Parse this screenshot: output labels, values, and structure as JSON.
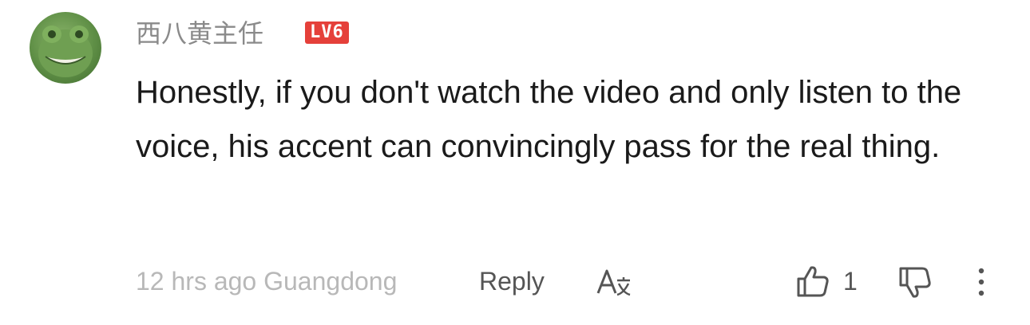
{
  "comment": {
    "username": "西八黄主任",
    "level_badge": "LV6",
    "text": "Honestly, if you don't watch the video and only listen to the voice, his accent can convincingly pass for the real thing.",
    "meta": "12 hrs ago Guangdong",
    "reply_label": "Reply",
    "like_count": "1",
    "icons": {
      "translate": "translate-icon",
      "like": "thumbs-up-icon",
      "dislike": "thumbs-down-icon",
      "more": "more-vertical-icon",
      "avatar": "avatar"
    },
    "colors": {
      "badge": "#e5403a",
      "text": "#1a1a1a",
      "muted": "#b8b8b8"
    }
  }
}
